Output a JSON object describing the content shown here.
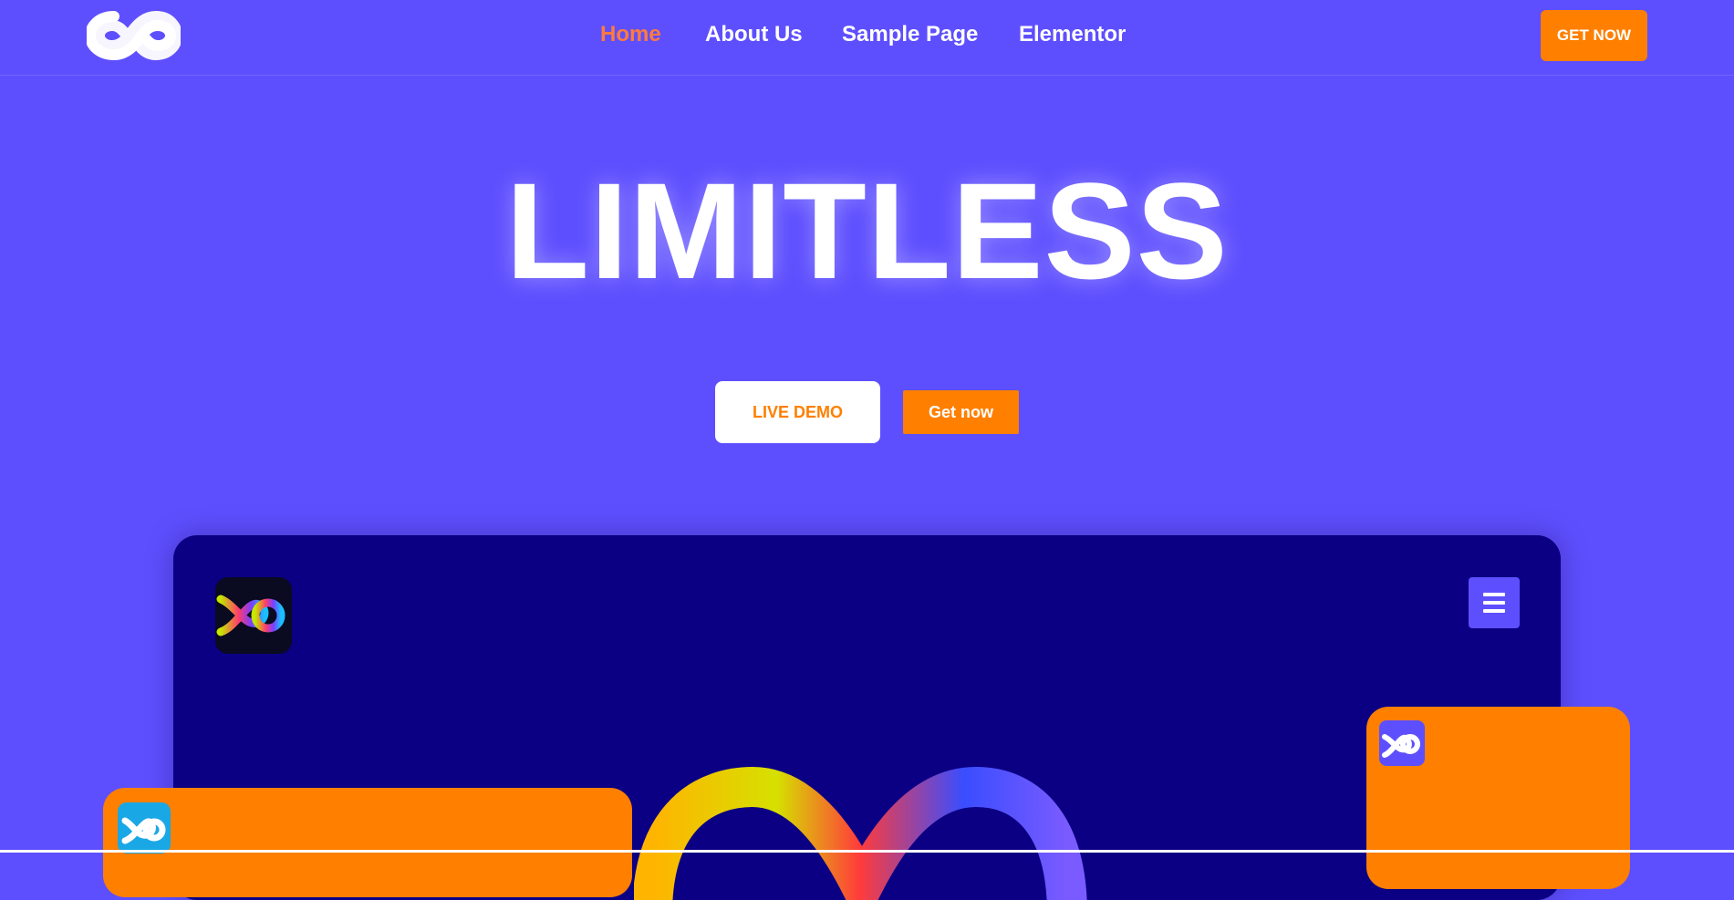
{
  "header": {
    "nav": [
      {
        "label": "Home",
        "active": true
      },
      {
        "label": "About Us",
        "active": false
      },
      {
        "label": "Sample Page",
        "active": false
      },
      {
        "label": "Elementor",
        "active": false
      }
    ],
    "cta_label": "GET NOW"
  },
  "hero": {
    "title": "LIMITLESS",
    "live_demo_label": "LIVE DEMO",
    "get_now_label": "Get now"
  },
  "icons": {
    "site_logo": "infinity-logo-icon",
    "panel_logo": "rainbow-infinity-logo-icon",
    "menu": "hamburger-menu-icon",
    "hero_art": "rainbow-infinity-icon"
  },
  "colors": {
    "background": "#5e4ffe",
    "accent": "#ff7f00",
    "active_nav": "#ff7a3d",
    "panel": "#0b0083"
  }
}
